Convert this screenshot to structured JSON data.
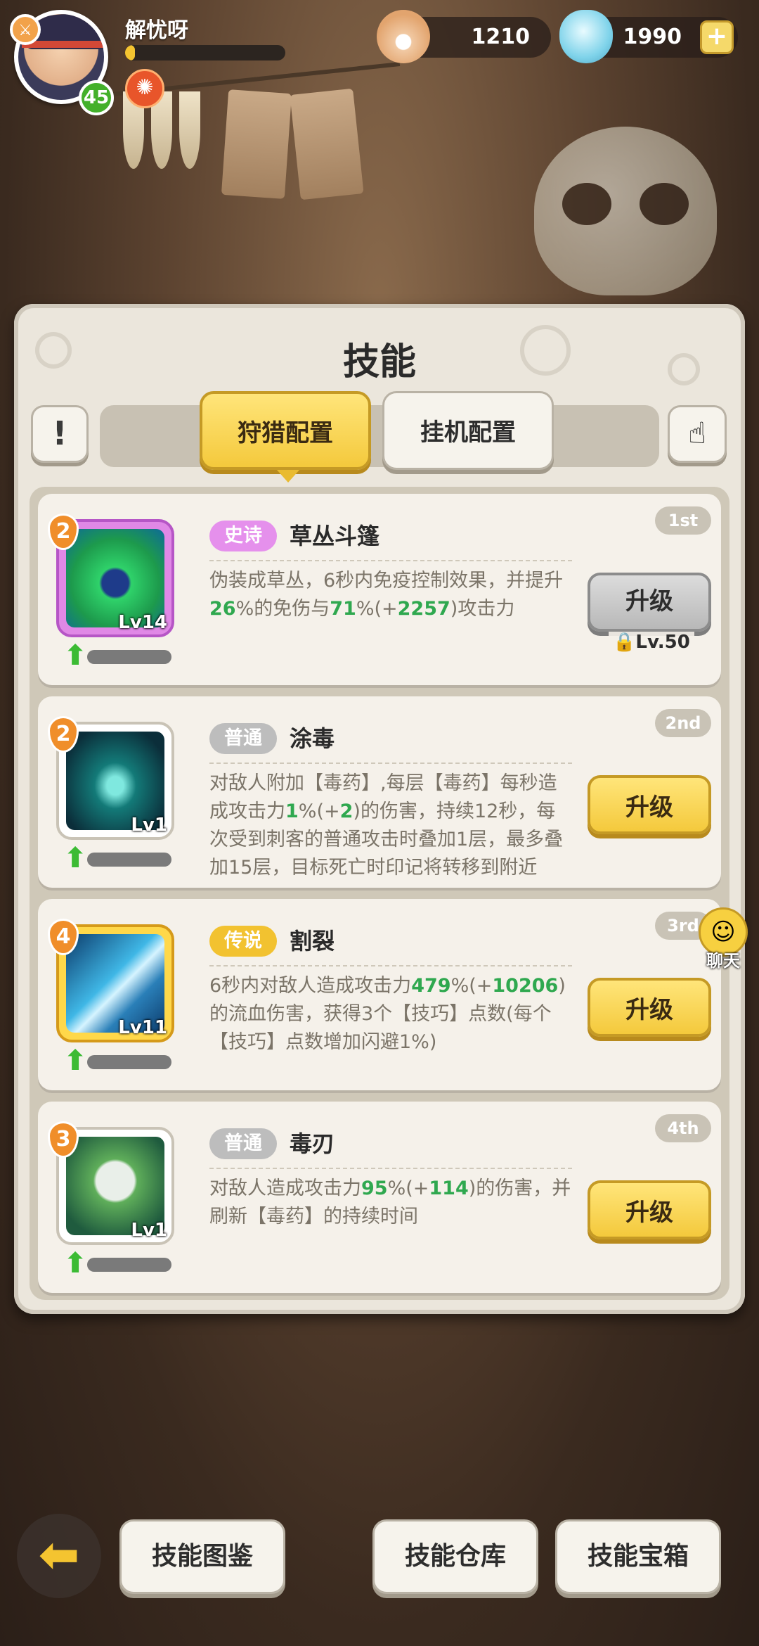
{
  "player": {
    "name": "解忧呀",
    "level": "45",
    "xp_fraction": 0.06
  },
  "currency": {
    "pearl": "1210",
    "gem": "1990",
    "add_icon": "plus-icon"
  },
  "panel": {
    "title": "技能",
    "tabs": [
      {
        "label": "狩猎配置",
        "active": true
      },
      {
        "label": "挂机配置",
        "active": false
      }
    ]
  },
  "skills": [
    {
      "rank": "1st",
      "star": "2",
      "rarity": "史诗",
      "name": "草丛斗篷",
      "level": "Lv14",
      "desc_parts": [
        {
          "t": "伪装成草丛，6秒内免疫控制效果，并提升"
        },
        {
          "t": "26",
          "g": true
        },
        {
          "t": "%的免伤与"
        },
        {
          "t": "71",
          "g": true
        },
        {
          "t": "%(+"
        },
        {
          "t": "2257",
          "g": true
        },
        {
          "t": ")攻击力"
        }
      ],
      "button": "升级",
      "locked": true,
      "lock_text": "Lv.50"
    },
    {
      "rank": "2nd",
      "star": "2",
      "rarity": "普通",
      "name": "涂毒",
      "level": "Lv1",
      "desc_parts": [
        {
          "t": "对敌人附加【毒药】,每层【毒药】每秒造成攻击力"
        },
        {
          "t": "1",
          "g": true
        },
        {
          "t": "%(+"
        },
        {
          "t": "2",
          "g": true
        },
        {
          "t": ")的伤害，持续12秒，每次受到刺客的普通攻击时叠加1层，最多叠加15层，目标死亡时印记将转移到附近"
        }
      ],
      "button": "升级",
      "locked": false
    },
    {
      "rank": "3rd",
      "star": "4",
      "rarity": "传说",
      "name": "割裂",
      "level": "Lv11",
      "desc_parts": [
        {
          "t": "6秒内对敌人造成攻击力"
        },
        {
          "t": "479",
          "g": true
        },
        {
          "t": "%(+"
        },
        {
          "t": "10206",
          "g": true
        },
        {
          "t": ")的流血伤害，获得3个【技巧】点数(每个【技巧】点数增加闪避1%)"
        }
      ],
      "button": "升级",
      "locked": false
    },
    {
      "rank": "4th",
      "star": "3",
      "rarity": "普通",
      "name": "毒刃",
      "level": "Lv1",
      "desc_parts": [
        {
          "t": "对敌人造成攻击力"
        },
        {
          "t": "95",
          "g": true
        },
        {
          "t": "%(+"
        },
        {
          "t": "114",
          "g": true
        },
        {
          "t": ")的伤害，并刷新【毒药】的持续时间"
        }
      ],
      "button": "升级",
      "locked": false
    }
  ],
  "chat": {
    "label": "聊天"
  },
  "bottom": {
    "buttons": [
      "技能图鉴",
      "技能仓库",
      "技能宝箱"
    ]
  }
}
